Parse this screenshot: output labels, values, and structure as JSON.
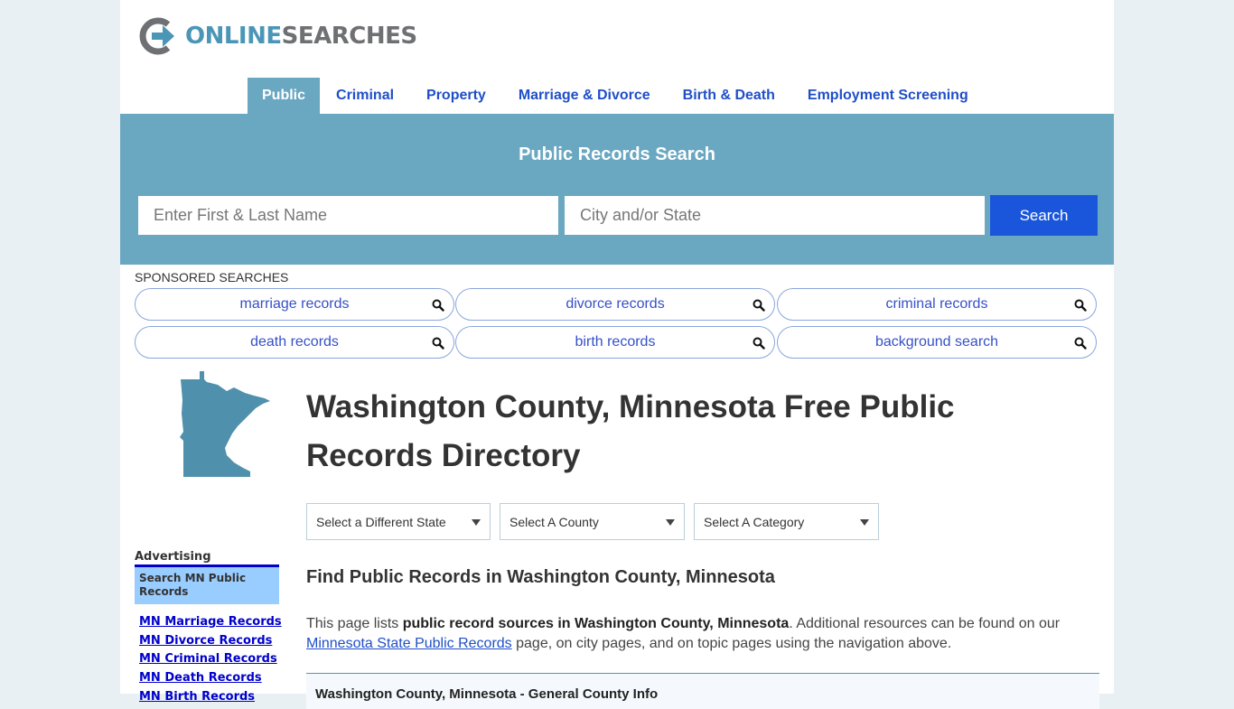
{
  "logo": {
    "part1": "ONLINE",
    "part2": "SEARCHES"
  },
  "nav": {
    "items": [
      {
        "label": "Public",
        "active": true
      },
      {
        "label": "Criminal"
      },
      {
        "label": "Property"
      },
      {
        "label": "Marriage & Divorce"
      },
      {
        "label": "Birth & Death"
      },
      {
        "label": "Employment Screening"
      }
    ]
  },
  "search": {
    "title": "Public Records Search",
    "name_placeholder": "Enter First & Last Name",
    "location_placeholder": "City and/or State",
    "button_label": "Search"
  },
  "sponsored": {
    "label": "SPONSORED SEARCHES",
    "items": [
      {
        "label": "marriage records",
        "icon": "search-icon"
      },
      {
        "label": "divorce records",
        "icon": "search-icon"
      },
      {
        "label": "criminal records",
        "icon": "search-icon"
      },
      {
        "label": "death records",
        "icon": "search-icon"
      },
      {
        "label": "birth records",
        "icon": "search-icon"
      },
      {
        "label": "background search",
        "icon": "search-icon"
      }
    ]
  },
  "colors": {
    "accent": "#6aa7c1",
    "button": "#1a56db",
    "link": "#1f4fc7",
    "state_map": "#4f90ad"
  },
  "main": {
    "title": "Washington County, Minnesota Free Public Records Directory",
    "selects": {
      "state": "Select a Different State",
      "county": "Select A County",
      "category": "Select A Category"
    },
    "section_title": "Find Public Records in Washington County, Minnesota",
    "intro": {
      "text1": "This page lists ",
      "bold": "public record sources in Washington County, Minnesota",
      "text2": ". Additional resources can be found on our ",
      "link": "Minnesota State Public Records",
      "text3": " page, on city pages, and on topic pages using the navigation above."
    },
    "info_box_title": "Washington County, Minnesota - General County Info"
  },
  "sidebar": {
    "advertising_label": "Advertising",
    "box_title": "Search MN Public Records",
    "links": [
      "MN Marriage Records",
      "MN Divorce Records",
      "MN Criminal Records",
      "MN Death Records",
      "MN Birth Records"
    ]
  }
}
